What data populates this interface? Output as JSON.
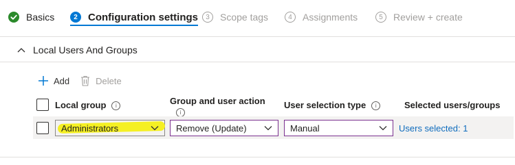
{
  "wizard": {
    "steps": [
      {
        "number": "",
        "label": "Basics",
        "state": "done"
      },
      {
        "number": "2",
        "label": "Configuration settings",
        "state": "current"
      },
      {
        "number": "3",
        "label": "Scope tags",
        "state": "pending"
      },
      {
        "number": "4",
        "label": "Assignments",
        "state": "pending"
      },
      {
        "number": "5",
        "label": "Review + create",
        "state": "pending"
      }
    ]
  },
  "section": {
    "title": "Local Users And Groups",
    "expanded": true
  },
  "toolbar": {
    "add_label": "Add",
    "delete_label": "Delete"
  },
  "grid": {
    "columns": {
      "local_group": "Local group",
      "group_user_action": "Group and user action",
      "user_selection_type": "User selection type",
      "selected_users": "Selected users/groups"
    },
    "rows": [
      {
        "local_group": "Administrators",
        "action": "Remove (Update)",
        "selection_type": "Manual",
        "selected": "Users selected: 1",
        "checked": false
      }
    ]
  },
  "colors": {
    "accent": "#0078d4",
    "done_green": "#2b8a2b",
    "dropdown_border": "#7a2f8f",
    "link": "#0f6cbd",
    "highlight": "#f5f023"
  }
}
